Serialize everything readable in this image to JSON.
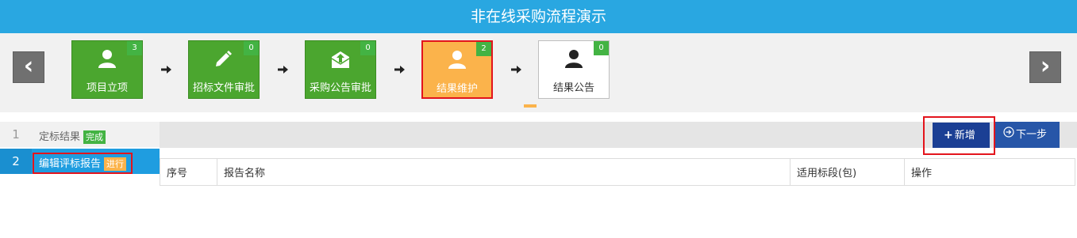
{
  "title": "非在线采购流程演示",
  "nav": {
    "prev_label": "‹",
    "next_label": "›"
  },
  "steps": [
    {
      "label": "项目立项",
      "count": "3",
      "icon": "user-icon",
      "state": "done"
    },
    {
      "label": "招标文件审批",
      "count": "0",
      "icon": "pencil-icon",
      "state": "done"
    },
    {
      "label": "采购公告审批",
      "count": "0",
      "icon": "envelope-upload-icon",
      "state": "done"
    },
    {
      "label": "结果维护",
      "count": "2",
      "icon": "user-icon",
      "state": "current"
    },
    {
      "label": "结果公告",
      "count": "0",
      "icon": "user-icon",
      "state": "pending"
    }
  ],
  "sidebar": {
    "items": [
      {
        "num": "1",
        "label": "定标结果",
        "tag": "完成"
      },
      {
        "num": "2",
        "label": "编辑评标报告",
        "tag": "进行"
      }
    ]
  },
  "toolbar": {
    "add_label": "新增",
    "next_label": "下一步"
  },
  "table": {
    "columns": [
      "序号",
      "报告名称",
      "适用标段(包)",
      "操作"
    ]
  },
  "colors": {
    "title_bar": "#29a7e1",
    "step_done": "#4ba62f",
    "step_current": "#fbb34b",
    "badge": "#43b343",
    "highlight_border": "#e3141c",
    "active_sidebar": "#1f9de0",
    "add_button": "#1b3f94",
    "next_button": "#2756a8"
  }
}
